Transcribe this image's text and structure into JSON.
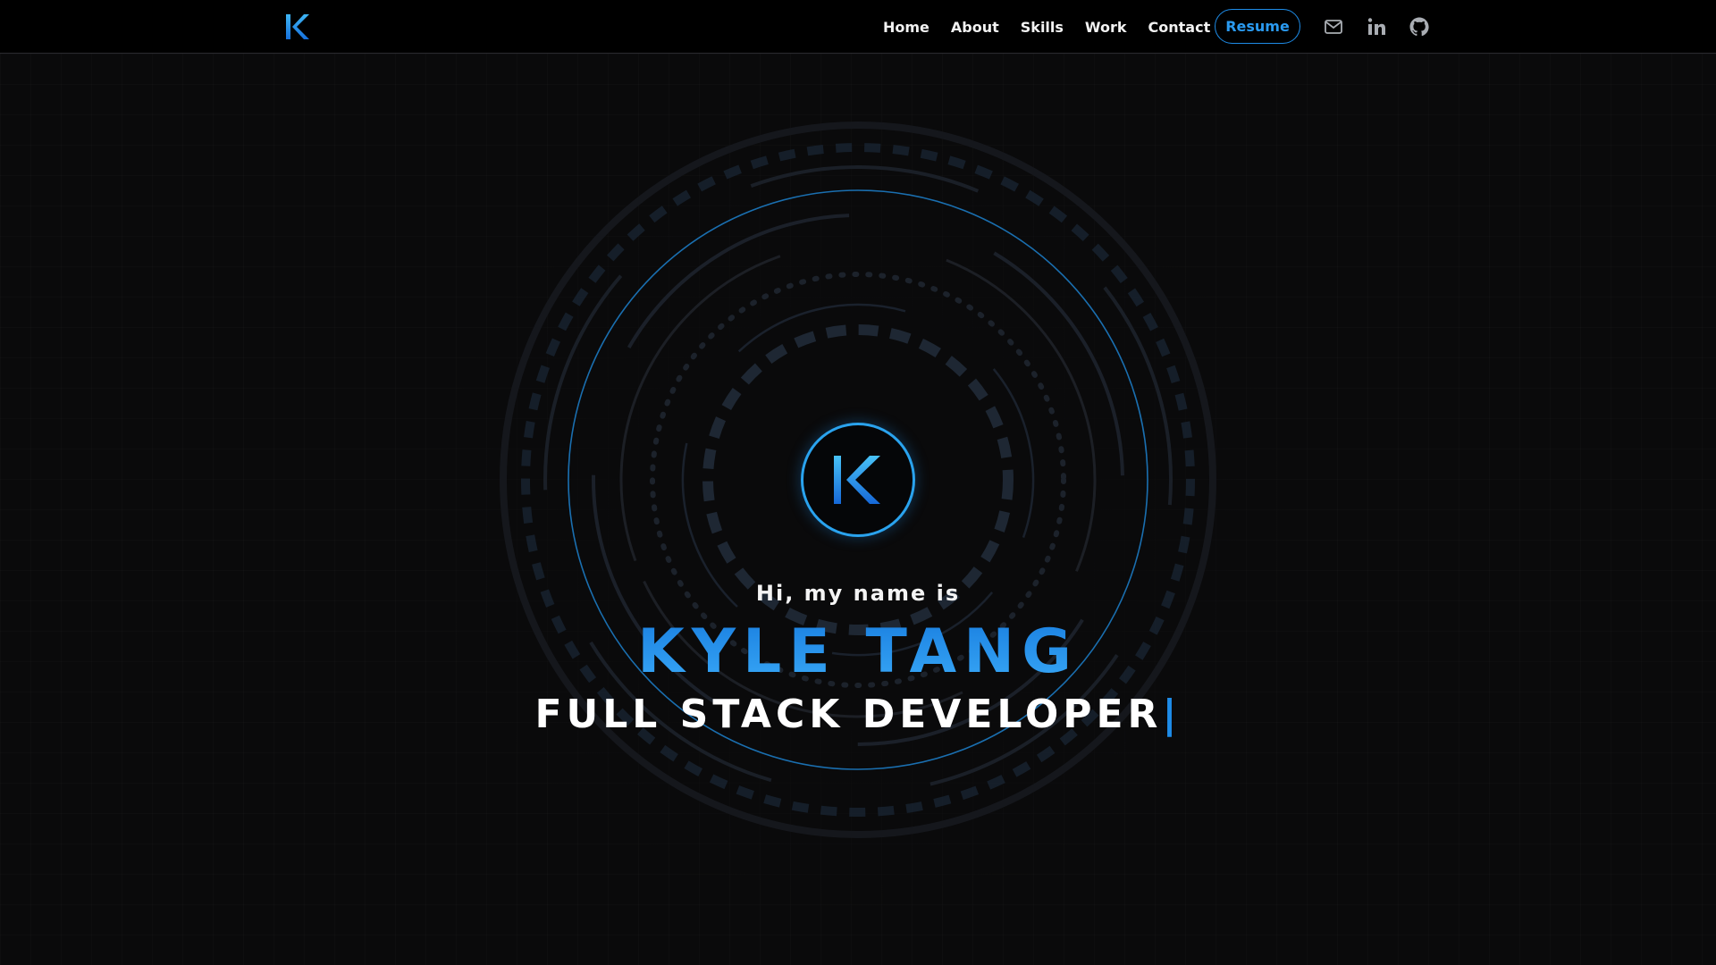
{
  "brand": {
    "logo_letter": "K",
    "accent": "#1e8ce8",
    "accent_light": "#39a9f7"
  },
  "nav": {
    "links": [
      "Home",
      "About",
      "Skills",
      "Work",
      "Contact"
    ],
    "resume_label": "Resume",
    "icons": [
      "mail-icon",
      "linkedin-icon",
      "github-icon"
    ]
  },
  "hero": {
    "avatar_letter": "K",
    "greeting": "Hi, my name is",
    "name": "KYLE TANG",
    "role": "FULL STACK DEVELOPER",
    "cursor": "|"
  }
}
